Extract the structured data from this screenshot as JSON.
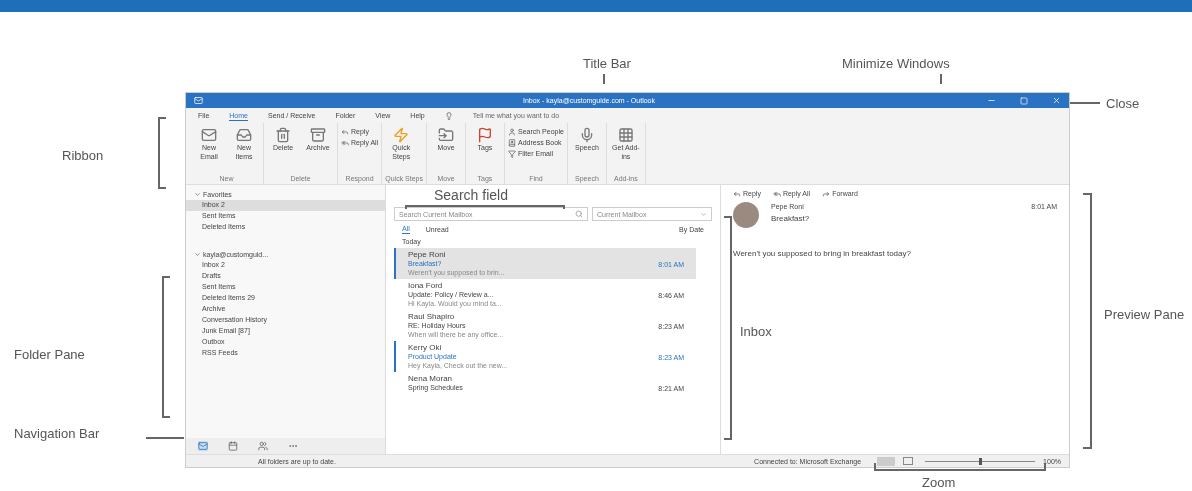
{
  "window": {
    "title": "Inbox - kayla@customguide.com - Outlook"
  },
  "tabs": [
    {
      "label": "File",
      "selected": false
    },
    {
      "label": "Home",
      "selected": true
    },
    {
      "label": "Send / Receive",
      "selected": false
    },
    {
      "label": "Folder",
      "selected": false
    },
    {
      "label": "View",
      "selected": false
    },
    {
      "label": "Help",
      "selected": false
    }
  ],
  "tell_me": {
    "placeholder": "Tell me what you want to do"
  },
  "ribbon": {
    "groups": [
      {
        "name": "New",
        "buttons": [
          {
            "label": "New Email",
            "kind": "large"
          },
          {
            "label": "New Items",
            "kind": "large"
          }
        ]
      },
      {
        "name": "Delete",
        "buttons": [
          {
            "label": "Delete",
            "kind": "large"
          },
          {
            "label": "Archive",
            "kind": "large"
          }
        ]
      },
      {
        "name": "Respond",
        "buttons": [
          {
            "label": "Reply",
            "kind": "small"
          },
          {
            "label": "Reply All",
            "kind": "small"
          }
        ]
      },
      {
        "name": "Quick Steps",
        "buttons": [
          {
            "label": "Quick Steps",
            "kind": "large"
          }
        ]
      },
      {
        "name": "Move",
        "buttons": [
          {
            "label": "Move",
            "kind": "large"
          }
        ]
      },
      {
        "name": "Tags",
        "buttons": [
          {
            "label": "Tags",
            "kind": "large"
          }
        ]
      },
      {
        "name": "Find",
        "buttons": [
          {
            "label": "Search People",
            "kind": "small"
          },
          {
            "label": "Address Book",
            "kind": "small"
          },
          {
            "label": "Filter Email",
            "kind": "small"
          }
        ]
      },
      {
        "name": "Speech",
        "buttons": [
          {
            "label": "Speech",
            "kind": "large"
          }
        ]
      },
      {
        "name": "Add-ins",
        "buttons": [
          {
            "label": "Get Add-ins",
            "kind": "large"
          }
        ]
      }
    ]
  },
  "folder_pane": {
    "sections": [
      {
        "label": "Favorites",
        "expanded": true,
        "items": [
          {
            "label": "Inbox 2",
            "selected": true
          },
          {
            "label": "Sent Items",
            "selected": false
          },
          {
            "label": "Deleted Items",
            "selected": false
          }
        ]
      },
      {
        "label": "kayla@customguid...",
        "expanded": true,
        "items": [
          {
            "label": "Inbox 2",
            "selected": false
          },
          {
            "label": "Drafts",
            "selected": false
          },
          {
            "label": "Sent Items",
            "selected": false
          },
          {
            "label": "Deleted Items 29",
            "selected": false
          },
          {
            "label": "Archive",
            "selected": false
          },
          {
            "label": "Conversation History",
            "selected": false
          },
          {
            "label": "Junk Email [87]",
            "selected": false
          },
          {
            "label": "Outbox",
            "selected": false
          },
          {
            "label": "RSS Feeds",
            "selected": false
          }
        ]
      }
    ]
  },
  "navigation_bar": {
    "items": [
      {
        "kind": "mail",
        "selected": true
      },
      {
        "kind": "calendar",
        "selected": false
      },
      {
        "kind": "people",
        "selected": false
      },
      {
        "kind": "more",
        "selected": false
      }
    ]
  },
  "search": {
    "placeholder": "Search Current Mailbox",
    "scope": "Current Mailbox"
  },
  "filters": [
    {
      "label": "All",
      "selected": true
    },
    {
      "label": "Unread",
      "selected": false
    }
  ],
  "sort": "By Date",
  "group": "Today",
  "messages": [
    {
      "sender": "Pepe Roni",
      "subject": "Breakfast?",
      "preview": "Weren't you supposed to brin...",
      "time": "8:01 AM",
      "selected": true,
      "unread": true
    },
    {
      "sender": "Iona Ford",
      "subject": "Update: Policy / Review a...",
      "preview": "Hi Kayla. Would you mind ta...",
      "time": "8:46 AM",
      "selected": false,
      "unread": false
    },
    {
      "sender": "Raul Shapiro",
      "subject": "RE: Holiday Hours",
      "preview": "When will there be any office...",
      "time": "8:23 AM",
      "selected": false,
      "unread": false
    },
    {
      "sender": "Kerry Oki",
      "subject": "Product Update",
      "preview": "Hey Kayla, Check out the new...",
      "time": "8:23 AM",
      "selected": false,
      "unread": true
    },
    {
      "sender": "Nena Moran",
      "subject": "Spring Schedules",
      "time": "8:21 AM",
      "selected": false,
      "unread": false
    }
  ],
  "reading": {
    "actions": [
      "Reply",
      "Reply All",
      "Forward"
    ],
    "sender": "Pepe Roni",
    "time": "8:01 AM",
    "subject": "Breakfast?",
    "body": "Weren't you supposed to bring in breakfast today?"
  },
  "status_bar": {
    "left": "All folders are up to date.",
    "connection": "Connected to: Microsoft Exchange",
    "zoom": "100%",
    "zoom_level": {
      "level": 0.5
    }
  },
  "annotations": [
    {
      "label": "Title Bar"
    },
    {
      "label": "Minimize Windows"
    },
    {
      "label": "Close"
    },
    {
      "label": "Ribbon"
    },
    {
      "label": "Search field"
    },
    {
      "label": "Folder Pane"
    },
    {
      "label": "Navigation Bar"
    },
    {
      "label": "Inbox"
    },
    {
      "label": "Preview Pane"
    },
    {
      "label": "Zoom"
    }
  ]
}
